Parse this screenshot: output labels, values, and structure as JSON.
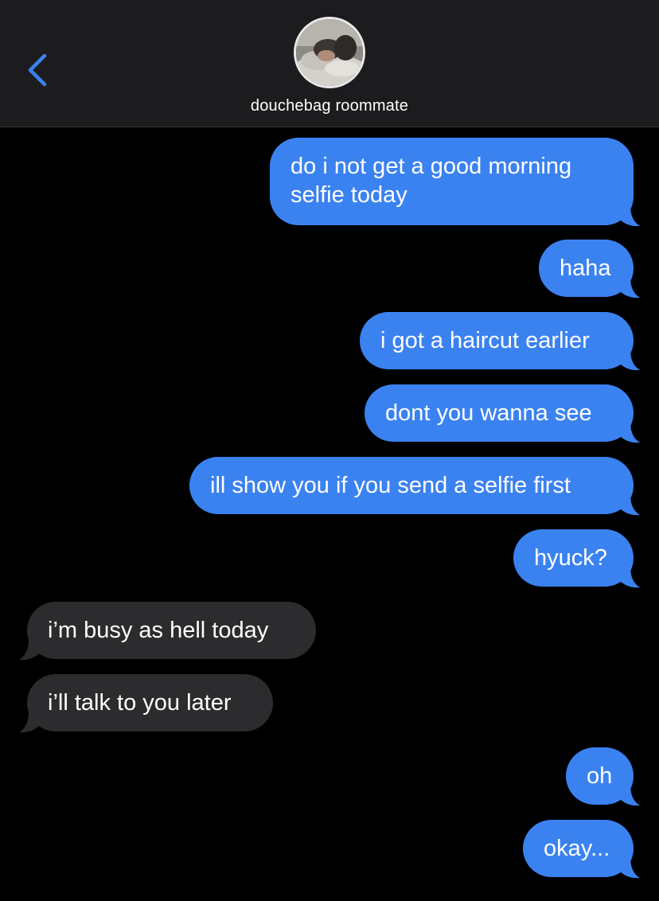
{
  "header": {
    "contact_name": "douchebag roommate"
  },
  "colors": {
    "sent_bubble": "#3b82f1",
    "received_bubble": "#2c2c2e",
    "header_bg": "#1c1c1e",
    "accent": "#3b82f1"
  },
  "icons": {
    "back": "chevron-left-icon"
  },
  "messages": [
    {
      "direction": "sent",
      "text": "do i not get a good morning selfie today"
    },
    {
      "direction": "sent",
      "text": "haha"
    },
    {
      "direction": "sent",
      "text": "i got a haircut earlier"
    },
    {
      "direction": "sent",
      "text": "dont you wanna see"
    },
    {
      "direction": "sent",
      "text": "ill show you if you send a selfie first"
    },
    {
      "direction": "sent",
      "text": "hyuck?"
    },
    {
      "direction": "received",
      "text": "i’m busy as hell today"
    },
    {
      "direction": "received",
      "text": "i’ll talk to you later"
    },
    {
      "direction": "sent",
      "text": "oh"
    },
    {
      "direction": "sent",
      "text": "okay..."
    }
  ]
}
